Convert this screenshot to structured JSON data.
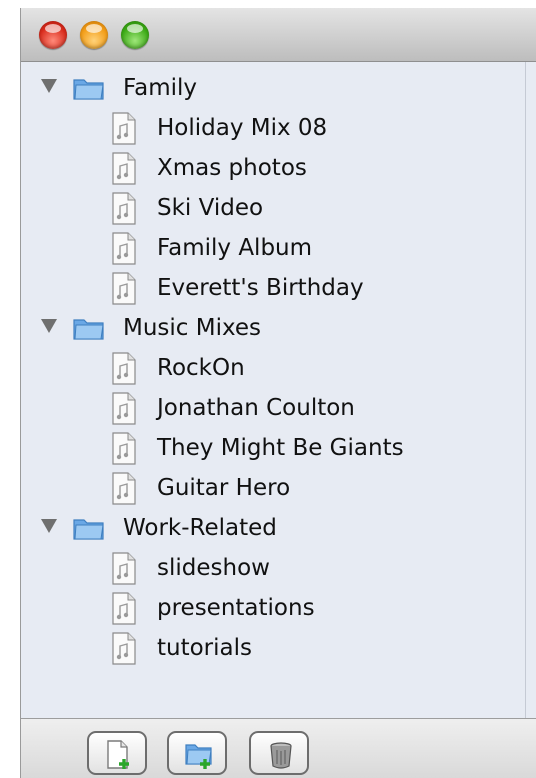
{
  "window": {
    "traffic_lights": {
      "close": "#d82b1c",
      "minimize": "#f29c16",
      "zoom": "#3ba915"
    }
  },
  "tree": {
    "groups": [
      {
        "label": "Family",
        "expanded": true,
        "icon": "folder-icon",
        "items": [
          {
            "label": "Holiday Mix 08",
            "icon": "document-icon"
          },
          {
            "label": "Xmas photos",
            "icon": "document-icon"
          },
          {
            "label": "Ski Video",
            "icon": "document-icon"
          },
          {
            "label": "Family Album",
            "icon": "document-icon"
          },
          {
            "label": "Everett's Birthday",
            "icon": "document-icon"
          }
        ]
      },
      {
        "label": "Music Mixes",
        "expanded": true,
        "icon": "folder-icon",
        "items": [
          {
            "label": "RockOn",
            "icon": "document-icon"
          },
          {
            "label": "Jonathan Coulton",
            "icon": "document-icon"
          },
          {
            "label": "They Might Be Giants",
            "icon": "document-icon"
          },
          {
            "label": "Guitar Hero",
            "icon": "document-icon"
          }
        ]
      },
      {
        "label": "Work-Related",
        "expanded": true,
        "icon": "folder-icon",
        "items": [
          {
            "label": "slideshow",
            "icon": "document-icon"
          },
          {
            "label": "presentations",
            "icon": "document-icon"
          },
          {
            "label": "tutorials",
            "icon": "document-icon"
          }
        ]
      }
    ]
  },
  "toolbar": {
    "buttons": [
      {
        "name": "new-document-button",
        "icon": "new-document-icon"
      },
      {
        "name": "new-folder-button",
        "icon": "new-folder-icon"
      },
      {
        "name": "delete-button",
        "icon": "trash-icon"
      }
    ],
    "accent": "#2aa52a"
  }
}
